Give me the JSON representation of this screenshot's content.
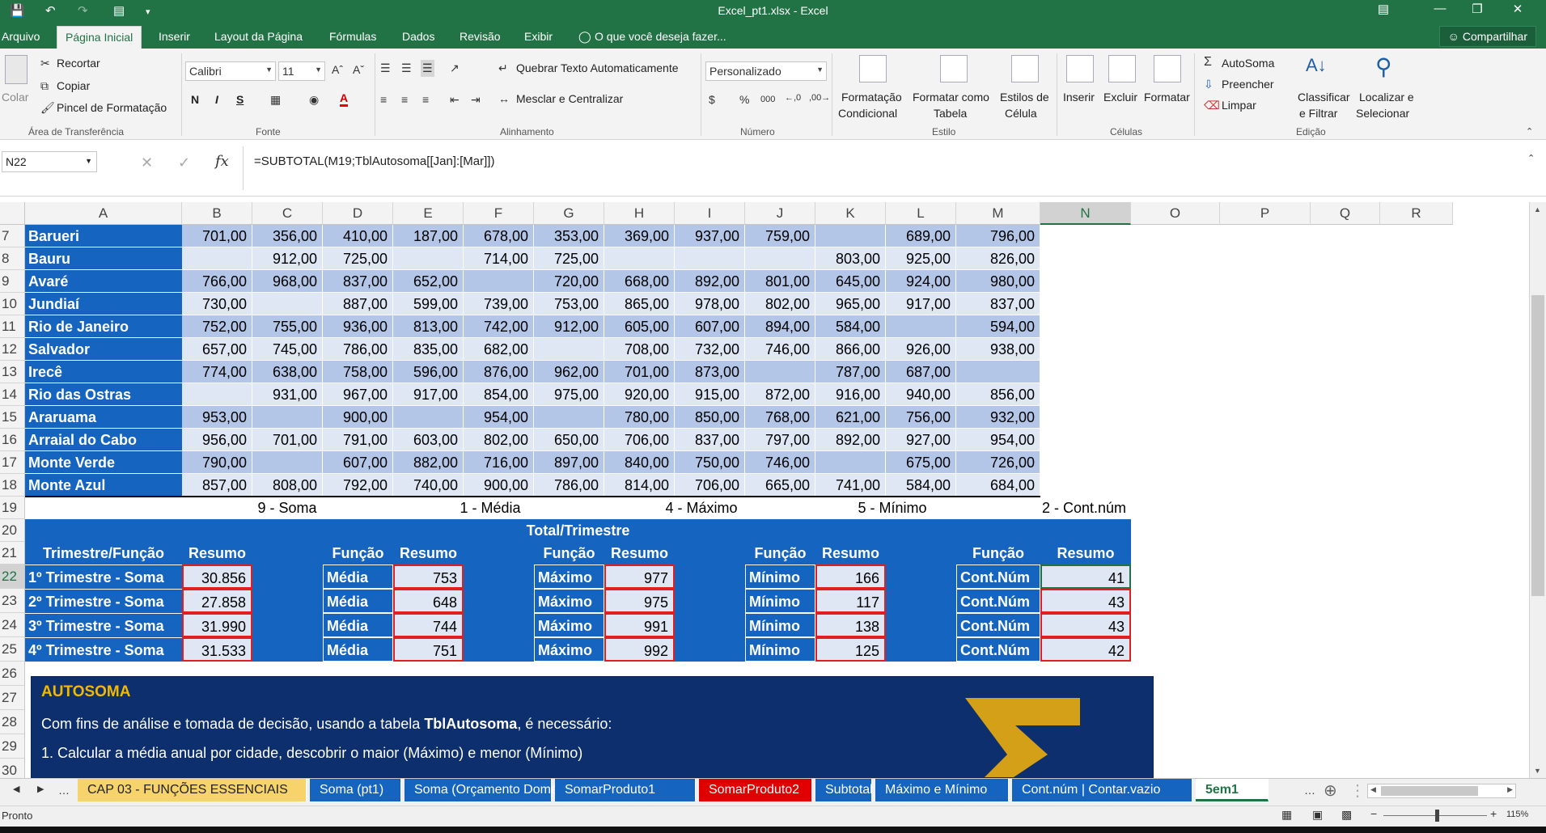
{
  "window": {
    "title": "Excel_pt1.xlsx - Excel"
  },
  "tabs": {
    "file": "Arquivo",
    "home": "Página Inicial",
    "insert": "Inserir",
    "layout": "Layout da Página",
    "formulas": "Fórmulas",
    "data": "Dados",
    "review": "Revisão",
    "view": "Exibir",
    "tell": "O que você deseja fazer...",
    "share": "Compartilhar"
  },
  "ribbon": {
    "clipboard": {
      "paste": "Colar",
      "cut": "Recortar",
      "copy": "Copiar",
      "painter": "Pincel de Formatação",
      "group": "Área de Transferência"
    },
    "font": {
      "name": "Calibri",
      "size": "11",
      "bold": "N",
      "italic": "I",
      "underline": "S",
      "group": "Fonte"
    },
    "alignment": {
      "wrap": "Quebrar Texto Automaticamente",
      "merge": "Mesclar e Centralizar",
      "group": "Alinhamento"
    },
    "number": {
      "format": "Personalizado",
      "group": "Número"
    },
    "styles": {
      "cond1": "Formatação",
      "cond2": "Condicional",
      "table1": "Formatar como",
      "table2": "Tabela",
      "cell1": "Estilos de",
      "cell2": "Célula",
      "group": "Estilo"
    },
    "cells": {
      "insert": "Inserir",
      "delete": "Excluir",
      "format": "Formatar",
      "group": "Células"
    },
    "editing": {
      "autosum": "AutoSoma",
      "fill": "Preencher",
      "clear": "Limpar",
      "sort1": "Classificar",
      "sort2": "e Filtrar",
      "find1": "Localizar e",
      "find2": "Selecionar",
      "group": "Edição"
    }
  },
  "formula_bar": {
    "name_box": "N22",
    "formula": "=SUBTOTAL(M19;TblAutosoma[[Jan]:[Mar]])"
  },
  "columns": [
    "A",
    "B",
    "C",
    "D",
    "E",
    "F",
    "G",
    "H",
    "I",
    "J",
    "K",
    "L",
    "M",
    "N",
    "O",
    "P",
    "Q",
    "R"
  ],
  "table_rows": [
    {
      "row": "7",
      "city": "Barueri",
      "values": [
        "701,00",
        "356,00",
        "410,00",
        "187,00",
        "678,00",
        "353,00",
        "369,00",
        "937,00",
        "759,00",
        "",
        "689,00",
        "796,00"
      ]
    },
    {
      "row": "8",
      "city": "Bauru",
      "values": [
        "",
        "912,00",
        "725,00",
        "",
        "714,00",
        "725,00",
        "",
        "",
        "",
        "803,00",
        "925,00",
        "826,00"
      ]
    },
    {
      "row": "9",
      "city": "Avaré",
      "values": [
        "766,00",
        "968,00",
        "837,00",
        "652,00",
        "",
        "720,00",
        "668,00",
        "892,00",
        "801,00",
        "645,00",
        "924,00",
        "980,00"
      ]
    },
    {
      "row": "10",
      "city": "Jundiaí",
      "values": [
        "730,00",
        "",
        "887,00",
        "599,00",
        "739,00",
        "753,00",
        "865,00",
        "978,00",
        "802,00",
        "965,00",
        "917,00",
        "837,00"
      ]
    },
    {
      "row": "11",
      "city": "Rio de Janeiro",
      "values": [
        "752,00",
        "755,00",
        "936,00",
        "813,00",
        "742,00",
        "912,00",
        "605,00",
        "607,00",
        "894,00",
        "584,00",
        "",
        "594,00"
      ]
    },
    {
      "row": "12",
      "city": "Salvador",
      "values": [
        "657,00",
        "745,00",
        "786,00",
        "835,00",
        "682,00",
        "",
        "708,00",
        "732,00",
        "746,00",
        "866,00",
        "926,00",
        "938,00"
      ]
    },
    {
      "row": "13",
      "city": "Irecê",
      "values": [
        "774,00",
        "638,00",
        "758,00",
        "596,00",
        "876,00",
        "962,00",
        "701,00",
        "873,00",
        "",
        "787,00",
        "687,00",
        ""
      ]
    },
    {
      "row": "14",
      "city": "Rio das Ostras",
      "values": [
        "",
        "931,00",
        "967,00",
        "917,00",
        "854,00",
        "975,00",
        "920,00",
        "915,00",
        "872,00",
        "916,00",
        "940,00",
        "856,00"
      ]
    },
    {
      "row": "15",
      "city": "Araruama",
      "values": [
        "953,00",
        "",
        "900,00",
        "",
        "954,00",
        "",
        "780,00",
        "850,00",
        "768,00",
        "621,00",
        "756,00",
        "932,00"
      ]
    },
    {
      "row": "16",
      "city": "Arraial do Cabo",
      "values": [
        "956,00",
        "701,00",
        "791,00",
        "603,00",
        "802,00",
        "650,00",
        "706,00",
        "837,00",
        "797,00",
        "892,00",
        "927,00",
        "954,00"
      ]
    },
    {
      "row": "17",
      "city": "Monte Verde",
      "values": [
        "790,00",
        "",
        "607,00",
        "882,00",
        "716,00",
        "897,00",
        "840,00",
        "750,00",
        "746,00",
        "",
        "675,00",
        "726,00"
      ]
    },
    {
      "row": "18",
      "city": "Monte Azul",
      "values": [
        "857,00",
        "808,00",
        "792,00",
        "740,00",
        "900,00",
        "786,00",
        "814,00",
        "706,00",
        "665,00",
        "741,00",
        "584,00",
        "684,00"
      ]
    }
  ],
  "row19": {
    "soma": "9 - Soma",
    "media": "1 - Média",
    "maximo": "4 - Máximo",
    "minimo": "5 - Mínimo",
    "contnum": "2  - Cont.núm"
  },
  "summary": {
    "title": "Total/Trimestre",
    "h_trim": "Trimestre/Função",
    "h_resumo": "Resumo",
    "h_funcao": "Função",
    "rows": [
      {
        "row": "22",
        "label": "1º Trimestre - Soma",
        "soma": "30.856",
        "media": "753",
        "max": "977",
        "min": "166",
        "cont": "41"
      },
      {
        "row": "23",
        "label": "2º Trimestre - Soma",
        "soma": "27.858",
        "media": "648",
        "max": "975",
        "min": "117",
        "cont": "43"
      },
      {
        "row": "24",
        "label": "3º Trimestre - Soma",
        "soma": "31.990",
        "media": "744",
        "max": "991",
        "min": "138",
        "cont": "43"
      },
      {
        "row": "25",
        "label": "4º Trimestre - Soma",
        "soma": "31.533",
        "media": "751",
        "max": "992",
        "min": "125",
        "cont": "42"
      }
    ],
    "f_media": "Média",
    "f_max": "Máximo",
    "f_min": "Mínimo",
    "f_cont": "Cont.Núm"
  },
  "note": {
    "title": "AUTOSOMA",
    "line1_pre": "Com fins de análise e tomada de decisão, usando a tabela ",
    "line1_bold": "TblAutosoma",
    "line1_post": ", é necessário:",
    "line2": "1. Calcular a média anual por cidade, descobrir o maior (Máximo) e menor (Mínimo)"
  },
  "extra_rows": [
    "19",
    "20",
    "21",
    "26",
    "27",
    "28",
    "29",
    "30"
  ],
  "sheet_tabs": [
    "CAP 03 - FUNÇÕES ESSENCIAIS",
    "Soma (pt1)",
    "Soma (Orçamento Doméstico)",
    "SomarProduto1",
    "SomarProduto2",
    "Subtotal",
    "Máximo e Mínimo",
    "Cont.núm | Contar.vazio",
    "5em1"
  ],
  "status": {
    "ready": "Pronto",
    "zoom": "115%"
  },
  "colors": {
    "excel_green": "#217346",
    "table_blue": "#1565c0",
    "band_light": "#dfe7f5",
    "band_mid": "#b4c6e7",
    "red": "#e02020",
    "note_bg": "#0d2f6e",
    "note_gold": "#f3b800"
  }
}
